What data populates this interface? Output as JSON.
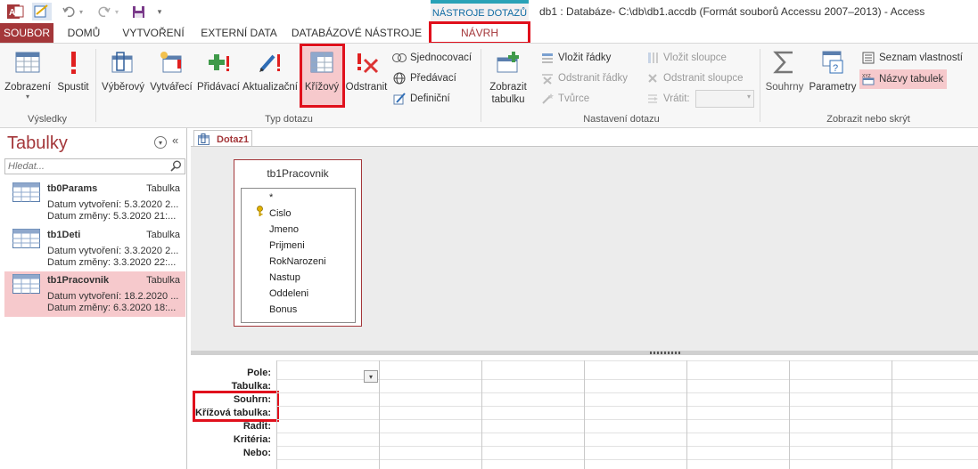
{
  "window": {
    "context_tab": "NÁSTROJE DOTAZŮ",
    "title": "db1 : Databáze- C:\\db\\db1.accdb (Formát souborů Accessu 2007–2013) - Access"
  },
  "quick_access": [
    "access-logo-icon",
    "design-view-icon",
    "undo-icon",
    "redo-icon",
    "save-icon",
    "customize-icon"
  ],
  "tabs": [
    {
      "label": "SOUBOR"
    },
    {
      "label": "DOMŮ"
    },
    {
      "label": "VYTVOŘENÍ"
    },
    {
      "label": "EXTERNÍ DATA"
    },
    {
      "label": "DATABÁZOVÉ NÁSTROJE"
    },
    {
      "label": "NÁVRH"
    }
  ],
  "ribbon": {
    "groups": {
      "results": "Výsledky",
      "query_type": "Typ dotazu",
      "query_setup": "Nastavení dotazu",
      "show_hide": "Zobrazit nebo skrýt"
    },
    "buttons": {
      "view": "Zobrazení",
      "run": "Spustit",
      "select": "Výběrový",
      "make_table": "Vytvářecí",
      "append": "Přidávací",
      "update": "Aktualizační",
      "crosstab": "Křížový",
      "delete": "Odstranit",
      "union": "Sjednocovací",
      "pass_through": "Předávací",
      "data_definition": "Definiční",
      "show_table_1": "Zobrazit",
      "show_table_2": "tabulku",
      "insert_rows": "Vložit řádky",
      "delete_rows": "Odstranit řádky",
      "builder": "Tvůrce",
      "insert_columns": "Vložit sloupce",
      "delete_columns": "Odstranit sloupce",
      "return": "Vrátit:",
      "totals": "Souhrny",
      "parameters": "Parametry",
      "property_sheet": "Seznam vlastností",
      "table_names": "Názvy tabulek"
    }
  },
  "nav": {
    "title": "Tabulky",
    "search_placeholder": "Hledat...",
    "items": [
      {
        "name": "tb0Params",
        "type": "Tabulka",
        "created": "Datum vytvoření: 5.3.2020 2...",
        "modified": "Datum změny: 5.3.2020 21:..."
      },
      {
        "name": "tb1Deti",
        "type": "Tabulka",
        "created": "Datum vytvoření: 3.3.2020 2...",
        "modified": "Datum změny: 3.3.2020 22:..."
      },
      {
        "name": "tb1Pracovnik",
        "type": "Tabulka",
        "created": "Datum vytvoření: 18.2.2020 ...",
        "modified": "Datum změny: 6.3.2020 18:..."
      }
    ]
  },
  "document": {
    "tab_label": "Dotaz1",
    "table_box": {
      "title": "tb1Pracovnik",
      "fields": [
        "*",
        "Cislo",
        "Jmeno",
        "Prijmeni",
        "RokNarozeni",
        "Nastup",
        "Oddeleni",
        "Bonus"
      ]
    },
    "grid_rows": [
      "Pole:",
      "Tabulka:",
      "Souhrn:",
      "Křížová tabulka:",
      "Řadit:",
      "Kritéria:",
      "Nebo:"
    ]
  }
}
